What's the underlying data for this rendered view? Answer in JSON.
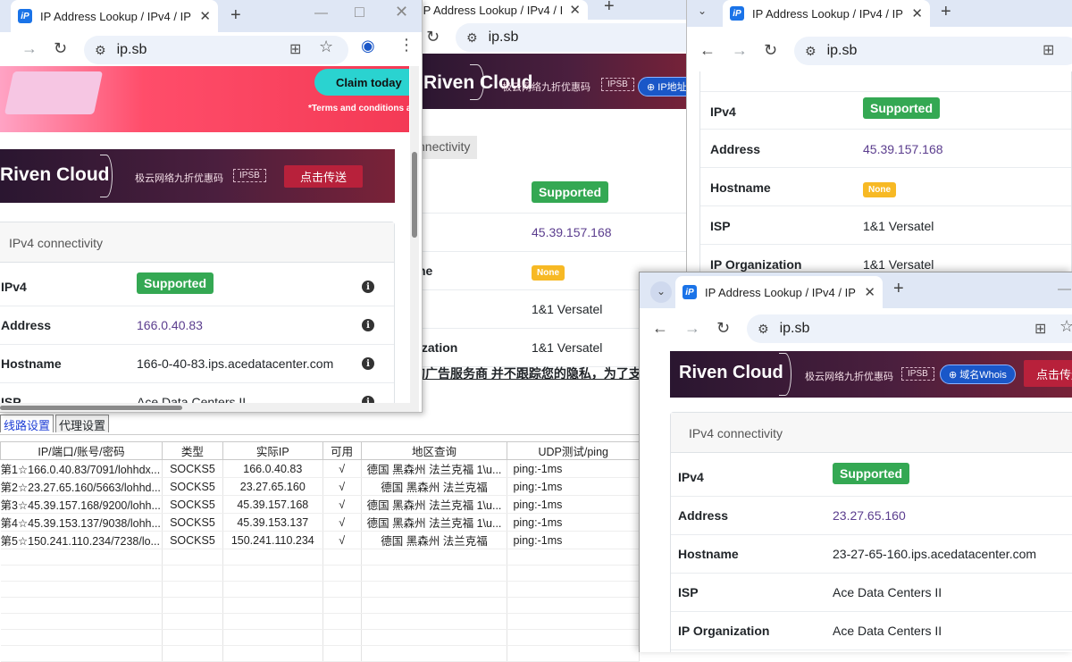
{
  "proxy_app": {
    "tabs": [
      "线路设置",
      "代理设置"
    ],
    "columns": [
      "IP/端口/账号/密码",
      "类型",
      "实际IP",
      "可用",
      "地区查询",
      "UDP测试/ping"
    ],
    "rows": [
      [
        "第1☆166.0.40.83/7091/lohhdx...",
        "SOCKS5",
        "166.0.40.83",
        "√",
        "德国 黑森州 法兰克福   1\\u...",
        "ping:-1ms"
      ],
      [
        "第2☆23.27.65.160/5663/lohhd...",
        "SOCKS5",
        "23.27.65.160",
        "√",
        "德国 黑森州 法兰克福",
        "ping:-1ms"
      ],
      [
        "第3☆45.39.157.168/9200/lohh...",
        "SOCKS5",
        "45.39.157.168",
        "√",
        "德国 黑森州 法兰克福   1\\u...",
        "ping:-1ms"
      ],
      [
        "第4☆45.39.153.137/9038/lohh...",
        "SOCKS5",
        "45.39.153.137",
        "√",
        "德国 黑森州 法兰克福   1\\u...",
        "ping:-1ms"
      ],
      [
        "第5☆150.241.110.234/7238/lo...",
        "SOCKS5",
        "150.241.110.234",
        "√",
        "德国 黑森州 法兰克福",
        "ping:-1ms"
      ]
    ]
  },
  "browser_common": {
    "tab_title": "IP Address Lookup / IPv4 / IP",
    "url": "ip.sb",
    "brand": "Riven Cloud",
    "promo": "极云网络九折优惠码",
    "promo_code": "IPSB",
    "cta": "点击传送",
    "whois_pill": "域名Whois",
    "ip_pill": "IP地址",
    "card_title": "IPv4 connectivity",
    "card_title_partial": "nnectivity",
    "claim_today": "Claim today",
    "terms": "*Terms and conditions a",
    "ad_text": "的广告服务商 并不跟踪您的隐私，为了支"
  },
  "labels": {
    "ipv4": "IPv4",
    "address": "Address",
    "hostname": "Hostname",
    "isp": "ISP",
    "org": "IP Organization",
    "hostname_partial": "ne",
    "org_partial": "ization",
    "isp_partial": "ISP"
  },
  "window1": {
    "supported": "Supported",
    "address": "166.0.40.83",
    "hostname": "166-0-40-83.ips.acedatacenter.com",
    "isp": "Ace Data Centers II"
  },
  "window2": {
    "supported": "Supported",
    "address": "45.39.157.168",
    "hostname": "None",
    "isp": "1&1 Versatel",
    "org": "1&1 Versatel"
  },
  "window3": {
    "supported": "Supported",
    "address": "45.39.157.168",
    "hostname": "None",
    "isp": "1&1 Versatel",
    "org": "1&1 Versatel"
  },
  "window4": {
    "supported": "Supported",
    "address": "23.27.65.160",
    "hostname": "23-27-65-160.ips.acedatacenter.com",
    "isp": "Ace Data Centers II",
    "org": "Ace Data Centers II"
  }
}
